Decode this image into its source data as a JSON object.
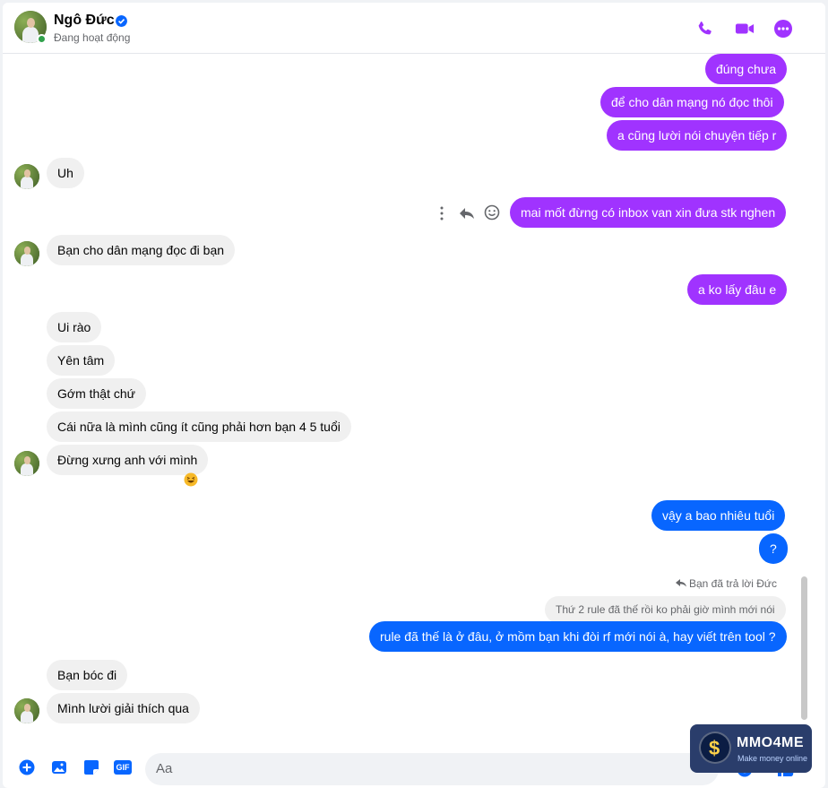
{
  "header": {
    "name": "Ngô Đức",
    "status": "Đang hoạt động",
    "icons": [
      "phone-icon",
      "video-icon",
      "more-icon"
    ]
  },
  "messages": {
    "m1": "đúng chưa",
    "m2": "để cho dân mạng nó đọc thôi",
    "m3": "a cũng lười nói chuyện tiếp r",
    "m4": "Uh",
    "m5": "mai mốt đừng có inbox van xin đưa stk nghen",
    "m6": "Bạn cho dân mạng đọc đi bạn",
    "m7": "a ko lấy đâu e",
    "m8": "Ui rào",
    "m9": "Yên tâm",
    "m10": "Gớm thật chứ",
    "m11": "Cái nữa là mình cũng ít cũng phải hơn bạn 4 5 tuổi",
    "m12": "Đừng xưng anh với mình",
    "m13": "vậy a bao nhiêu tuổi",
    "m14": "?",
    "reply_meta": "Bạn đã trả lời Đức",
    "reply_quote": "Thứ 2 rule đã thế rồi ko phải giờ mình mới nói",
    "m15": "rule đã thế là ở đâu, ở mồm bạn khi đòi rf mới nói à, hay viết trên tool ?",
    "m16": "Bạn bóc đi",
    "m17": "Mình lười giải thích qua"
  },
  "composer": {
    "placeholder": "Aa",
    "icons": [
      "plus-icon",
      "image-icon",
      "sticker-icon",
      "gif-icon",
      "emoji-icon",
      "like-icon"
    ],
    "gif_label": "GIF"
  },
  "watermark": {
    "brand": "MMO4ME",
    "tagline": "Make money online"
  },
  "colors": {
    "purple": "#a033ff",
    "blue": "#0866ff",
    "accent": "#a033ff"
  }
}
